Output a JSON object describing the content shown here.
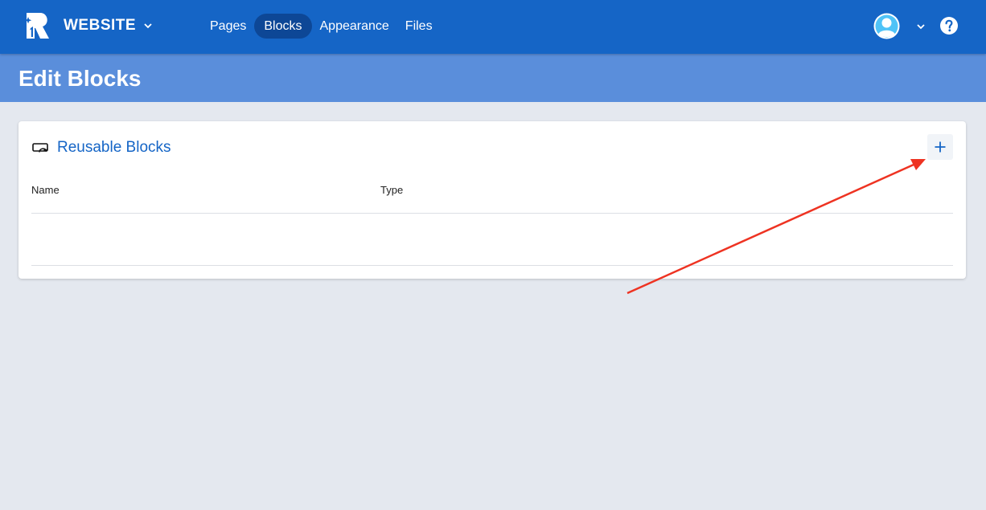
{
  "header": {
    "site_name": "WEBSITE",
    "nav": [
      {
        "label": "Pages",
        "active": false
      },
      {
        "label": "Blocks",
        "active": true
      },
      {
        "label": "Appearance",
        "active": false
      },
      {
        "label": "Files",
        "active": false
      }
    ]
  },
  "page": {
    "title": "Edit Blocks"
  },
  "card": {
    "title": "Reusable Blocks",
    "columns": [
      "Name",
      "Type"
    ],
    "rows": []
  },
  "icons": {
    "logo": "brand-logo",
    "site_dropdown": "chevron-down-icon",
    "user": "user-avatar-icon",
    "user_dropdown": "chevron-down-icon",
    "help": "help-icon",
    "card": "reusable-block-icon",
    "add": "plus-icon"
  },
  "colors": {
    "topbar": "#1565c6",
    "active_nav": "#0d4796",
    "header_band": "#5a8edb",
    "background": "#e4e8ef",
    "annotation_arrow": "#ee3322"
  }
}
